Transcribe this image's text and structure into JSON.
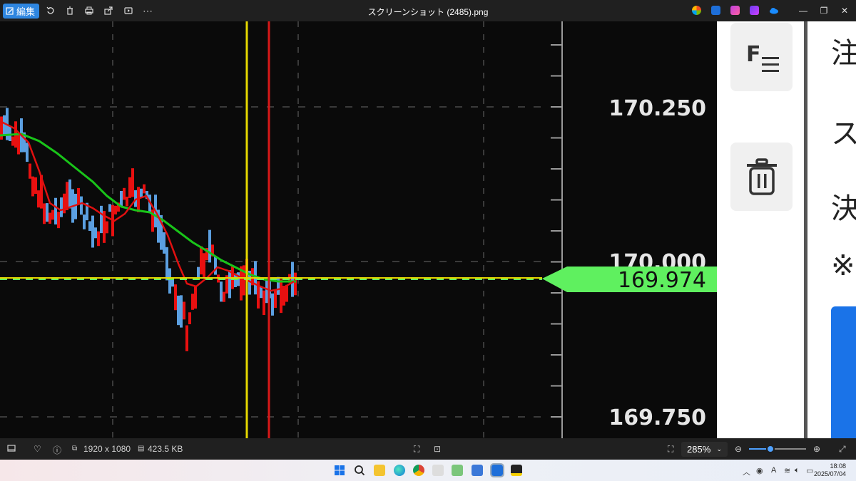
{
  "titlebar": {
    "edit_label": "編集",
    "file_title": "スクリーンショット (2485).png"
  },
  "chart": {
    "price_top": "170.250",
    "price_mid": "170.000",
    "price_bottom": "169.750",
    "current_price": "169.974",
    "current_price_color": "#5ff05f",
    "crosshair_yellow": "#e6d800",
    "crosshair_red": "#d81818",
    "ma_red_color": "#e01010",
    "ma_green_color": "#19c419",
    "candle_up_color": "#5b9fe0",
    "candle_down_color": "#e81010"
  },
  "side_panel": {
    "text_1": "注",
    "text_2": "ス",
    "text_3": "決",
    "text_4": "※"
  },
  "statusbar": {
    "dimensions": "1920 x 1080",
    "filesize": "423.5 KB",
    "zoom": "285%",
    "zoom_slider_fraction": 0.38
  },
  "taskbar": {
    "time": "18:08",
    "date": "2025/07/04",
    "ime": "A"
  }
}
